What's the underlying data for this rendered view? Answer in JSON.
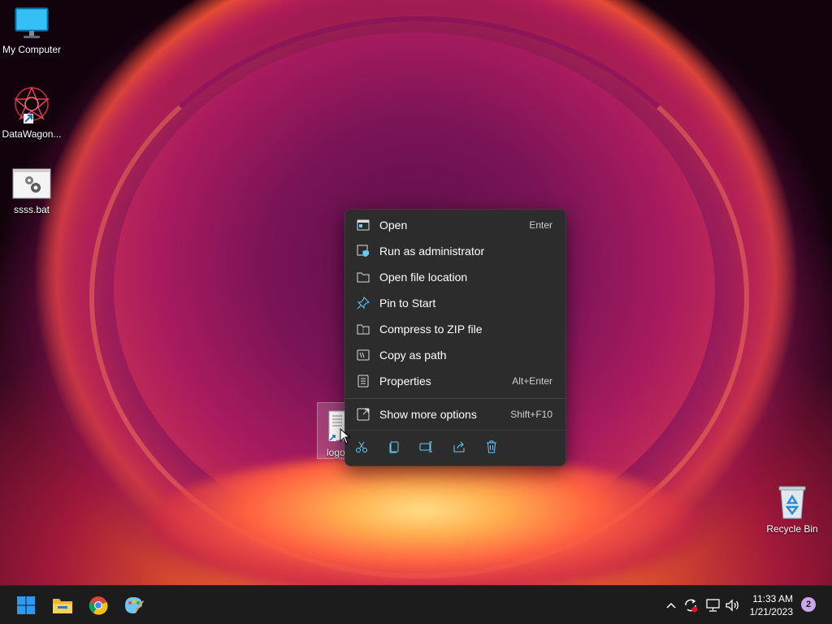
{
  "desktop": {
    "icons": [
      {
        "label": "My Computer",
        "icon": "monitor-icon"
      },
      {
        "label": "DataWagon...",
        "icon": "datawagon-app-icon"
      },
      {
        "label": "ssss.bat",
        "icon": "batch-file-icon"
      },
      {
        "label": "logo",
        "icon": "text-file-shortcut-icon"
      },
      {
        "label": "Recycle Bin",
        "icon": "recycle-bin-icon"
      }
    ]
  },
  "context_menu": {
    "items": [
      {
        "label": "Open",
        "shortcut": "Enter",
        "icon": "open-icon"
      },
      {
        "label": "Run as administrator",
        "shortcut": "",
        "icon": "shield-app-icon"
      },
      {
        "label": "Open file location",
        "shortcut": "",
        "icon": "folder-icon"
      },
      {
        "label": "Pin to Start",
        "shortcut": "",
        "icon": "pin-icon"
      },
      {
        "label": "Compress to ZIP file",
        "shortcut": "",
        "icon": "zip-folder-icon"
      },
      {
        "label": "Copy as path",
        "shortcut": "",
        "icon": "copy-path-icon"
      },
      {
        "label": "Properties",
        "shortcut": "Alt+Enter",
        "icon": "properties-icon"
      },
      {
        "label": "Show more options",
        "shortcut": "Shift+F10",
        "icon": "more-options-icon"
      }
    ],
    "quick_actions": [
      "cut-icon",
      "copy-icon",
      "rename-icon",
      "share-icon",
      "delete-icon"
    ]
  },
  "taskbar": {
    "apps": [
      "start-icon",
      "file-explorer-icon",
      "chrome-icon",
      "paint-icon"
    ],
    "tray": [
      "chevron-up-icon",
      "sync-icon",
      "network-icon",
      "volume-icon"
    ],
    "time": "11:33 AM",
    "date": "1/21/2023",
    "notifications": "2"
  },
  "colors": {
    "menu_bg": "#2c2c2c",
    "taskbar_bg": "#1c1c1c",
    "accent": "#60cdff"
  }
}
